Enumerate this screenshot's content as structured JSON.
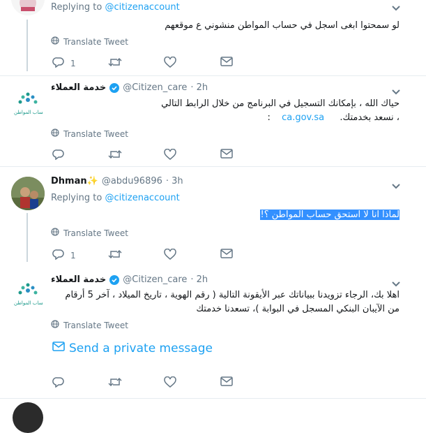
{
  "tweets": [
    {
      "name": "",
      "handle": "",
      "time": "",
      "replying_prefix": "Replying to",
      "replying_to": "@citizenaccount",
      "text": "لو سمحتوا ابغى اسجل في حساب المواطن منشوني ع موقعهم",
      "translate": "Translate Tweet",
      "reply_count": "1",
      "retweet_count": "",
      "like_count": ""
    },
    {
      "name": "خدمة العملاء",
      "handle": "@Citizen_care",
      "time": "· 2h",
      "line1": "حياك الله ،  بإمكانك التسجيل في البرنامج من خلال الرابط التالي",
      "line2_link": "ca.gov.sa",
      "line2_rest": "،  نسعد بخدمتك.",
      "line2_colon": ":",
      "translate": "Translate Tweet",
      "reply_count": "",
      "retweet_count": "",
      "like_count": ""
    },
    {
      "name": "Dhman",
      "name_emoji": "✨",
      "handle": "@abdu96896",
      "time": "· 3h",
      "replying_prefix": "Replying to",
      "replying_to": "@citizenaccount",
      "text": "لماذا انا لا استحق حساب المواطن ؟!",
      "translate": "Translate Tweet",
      "reply_count": "1",
      "retweet_count": "",
      "like_count": ""
    },
    {
      "name": "خدمة العملاء",
      "handle": "@Citizen_care",
      "time": "· 2h",
      "line1": "اهلا بك، الرجاء تزويدنا ببياناتك عبر الأيقونة التالية ( رقم الهوية ، تاريخ الميلاد ، آخر 5 أرقام",
      "line2": "من الآيبان البنكي المسجل في البوابة )، تسعدنا خدمتك",
      "translate": "Translate Tweet",
      "dm_label": "Send a private message",
      "reply_count": "",
      "retweet_count": "",
      "like_count": ""
    }
  ],
  "logo_caption": "حساب المواطن",
  "colors": {
    "accent": "#1da1f2",
    "secondary_text": "#657786",
    "divider": "#e6ecf0",
    "selection": "#3390ff"
  },
  "icons": [
    "globe-icon",
    "reply-icon",
    "retweet-icon",
    "like-icon",
    "message-icon",
    "chevron-down-icon",
    "verified-badge-icon",
    "envelope-icon"
  ]
}
